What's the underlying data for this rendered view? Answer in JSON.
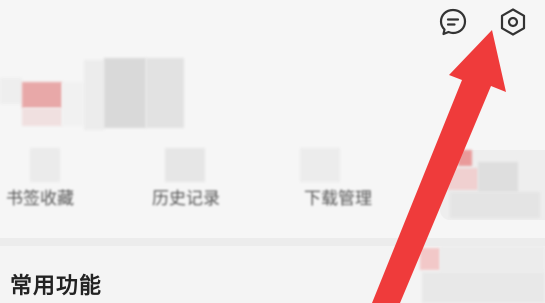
{
  "header": {
    "message_icon": "chat-bubble-icon",
    "settings_icon": "hexagon-settings-icon"
  },
  "quick_actions": [
    {
      "label": "书签收藏"
    },
    {
      "label": "历史记录"
    },
    {
      "label": "下载管理"
    }
  ],
  "section": {
    "title": "常用功能"
  },
  "colors": {
    "accent_red": "#ef3b3b",
    "mosaic_pink": "#e8a5a5",
    "mosaic_gray": "#d8d8d8",
    "text_dark": "#222222"
  }
}
